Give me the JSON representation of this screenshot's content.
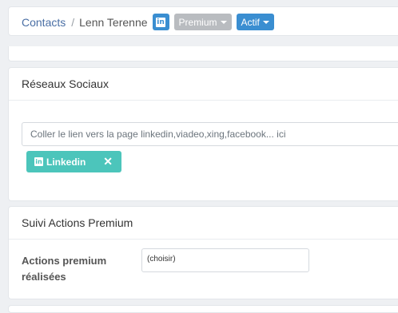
{
  "breadcrumb": {
    "root": "Contacts",
    "separator": "/",
    "current": "Lenn Terenne"
  },
  "header": {
    "linkedin_icon": "linkedin-icon",
    "premium_label": "Premium",
    "status_label": "Actif"
  },
  "social": {
    "title": "Réseaux Sociaux",
    "input_placeholder": "Coller le lien vers la page linkedin,viadeo,xing,facebook... ici",
    "tag_label": "Linkedin",
    "tag_remove": "✕"
  },
  "premium_actions": {
    "title": "Suivi Actions Premium",
    "field_label_line1": "Actions premium",
    "field_label_line2": "réalisées",
    "select_value": "(choisir)"
  },
  "colors": {
    "accent_blue": "#3a8ed1",
    "tag_teal": "#4cc5bb",
    "pill_grey": "#b9bcc0"
  }
}
